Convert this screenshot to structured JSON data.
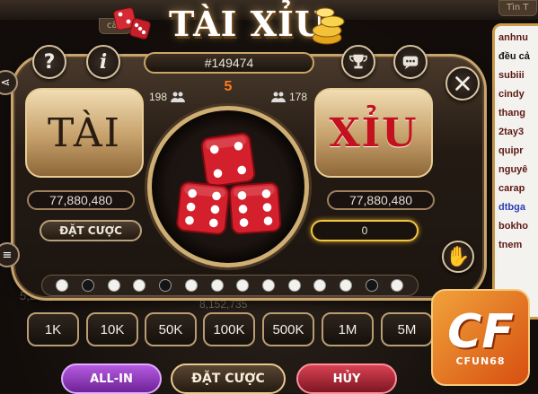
{
  "game": {
    "title": "TÀI XỈU",
    "session_id": "#149474",
    "countdown": "5",
    "tai": {
      "label": "TÀI",
      "players": "198",
      "total": "77,880,480",
      "action_label": "ĐẶT CƯỢC"
    },
    "xiu": {
      "label": "XỈU",
      "players": "178",
      "total": "77,880,480",
      "bet_value": "0"
    },
    "dice": [
      4,
      6,
      6
    ],
    "history": [
      "white",
      "black",
      "white",
      "white",
      "black",
      "white",
      "white",
      "white",
      "white",
      "white",
      "white",
      "white",
      "black",
      "white"
    ]
  },
  "background": {
    "tabs": [
      "cầu",
      "Tìn T"
    ],
    "left_amount": "5,280,524",
    "mid_amount": "8,152,735"
  },
  "chips": [
    "1K",
    "10K",
    "50K",
    "100K",
    "500K",
    "1M",
    "5M"
  ],
  "actions": {
    "allin": "ALL-IN",
    "bet": "ĐẶT CƯỢC",
    "cancel": "HỦY"
  },
  "chat": [
    "anhnu",
    "đều cả",
    "subiii",
    "cindy",
    "thang",
    "2tay3",
    "quipr",
    "nguyê",
    "carap",
    "dtbga",
    "bokho",
    "tnem"
  ],
  "logo": {
    "mark": "CF",
    "text": "CFUN68"
  },
  "colors": {
    "gold": "#c8a56b",
    "timer": "#ff7a1f",
    "xiu_red": "#c3121e",
    "bet_highlight": "#f0c640"
  }
}
